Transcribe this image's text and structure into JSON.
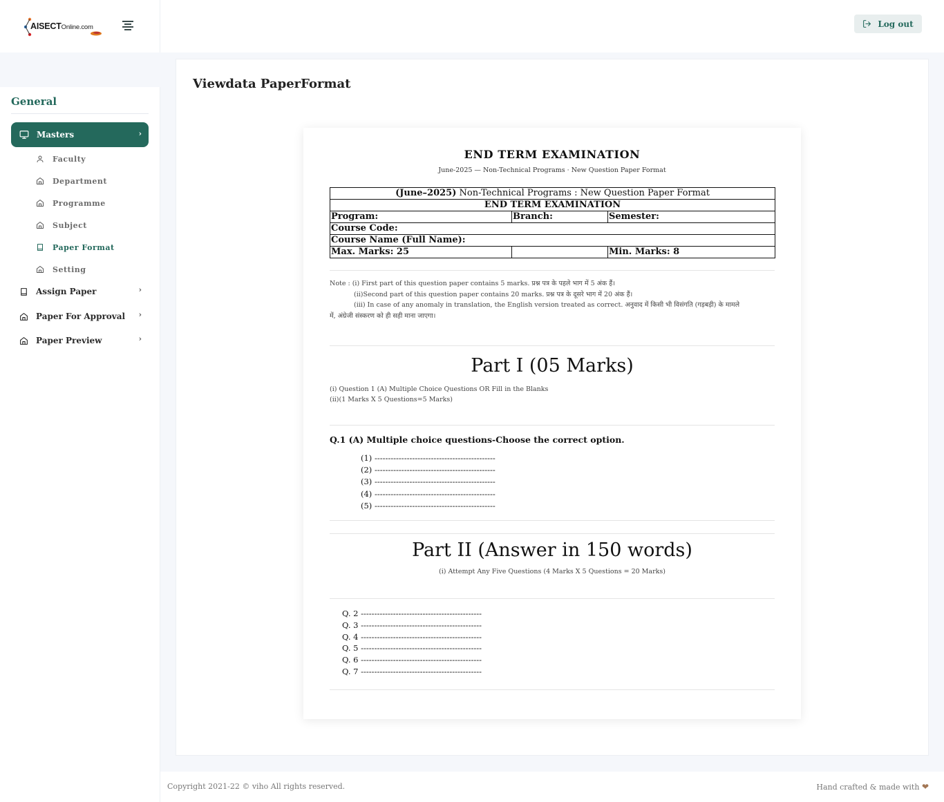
{
  "header": {
    "logo_brand": "AISECT",
    "logo_suffix": "Online.com",
    "logout_label": "Log out"
  },
  "sidebar": {
    "section_title": "General",
    "active_item": "Masters",
    "sub_items": [
      "Faculty",
      "Department",
      "Programme",
      "Subject",
      "Paper Format",
      "Setting"
    ],
    "active_sub_item": "Paper Format",
    "items": [
      "Assign Paper",
      "Paper For Approval",
      "Paper Preview"
    ]
  },
  "page": {
    "title": "Viewdata PaperFormat"
  },
  "paper": {
    "heading": "END TERM EXAMINATION",
    "subheading": "June-2025 — Non-Technical Programs · New Question Paper Format",
    "table": {
      "row1_bold": "(June–2025)",
      "row1_rest": " Non-Technical Programs : New Question Paper Format",
      "row2": "END TERM EXAMINATION",
      "program": "Program:",
      "branch": "Branch:",
      "semester": "Semester:",
      "course_code": "Course Code:",
      "course_name": "Course Name (Full Name):",
      "max_marks": "Max. Marks: 25",
      "min_marks": "Min. Marks: 8"
    },
    "note": {
      "line1": "Note : (i) First part of this question paper contains 5 marks. प्रश्न पत्र के पहले भाग में 5 अंक हैं।",
      "line2": "(ii)Second part of this question paper contains 20 marks. प्रश्न पत्र के दूसरे भाग में 20 अंक हैं।",
      "line3": "(iii) In case of any anomaly in translation, the English version treated as correct. अनुवाद में किसी भी विसंगति (गड़बड़ी) के मामले",
      "line4": "में, अंग्रेजी संस्करण को ही सही माना जाएगा।"
    },
    "part1": {
      "title": "Part I (05 Marks)",
      "desc1": "(i) Question 1 (A) Multiple Choice Questions OR Fill in the Blanks",
      "desc2": "(ii)(1 Marks X 5 Questions=5 Marks)",
      "question_heading": "Q.1 (A) Multiple choice questions-Choose the correct option.",
      "options": [
        "(1) ---------------------------------------------",
        "(2) ---------------------------------------------",
        "(3) ---------------------------------------------",
        "(4) ---------------------------------------------",
        "(5) ---------------------------------------------"
      ]
    },
    "part2": {
      "title": "Part II (Answer in 150 words)",
      "desc": "(i) Attempt Any Five Questions (4 Marks X 5 Questions = 20 Marks)",
      "questions": [
        "Q. 2 ---------------------------------------------",
        "Q. 3 ---------------------------------------------",
        "Q. 4 ---------------------------------------------",
        "Q. 5 ---------------------------------------------",
        "Q. 6 ---------------------------------------------",
        "Q. 7 ---------------------------------------------"
      ]
    }
  },
  "footer": {
    "copyright": "Copyright 2021-22 © viho All rights reserved.",
    "made_with": "Hand crafted & made with",
    "heart": "❤"
  },
  "colors": {
    "accent": "#24695c",
    "background": "#f5f7fb",
    "heart": "#a27654"
  },
  "icons": [
    "hamburger-icon",
    "logout-icon",
    "monitor-icon",
    "user-icon",
    "home-icon",
    "book-icon",
    "chevron-right-icon",
    "heart-icon"
  ]
}
